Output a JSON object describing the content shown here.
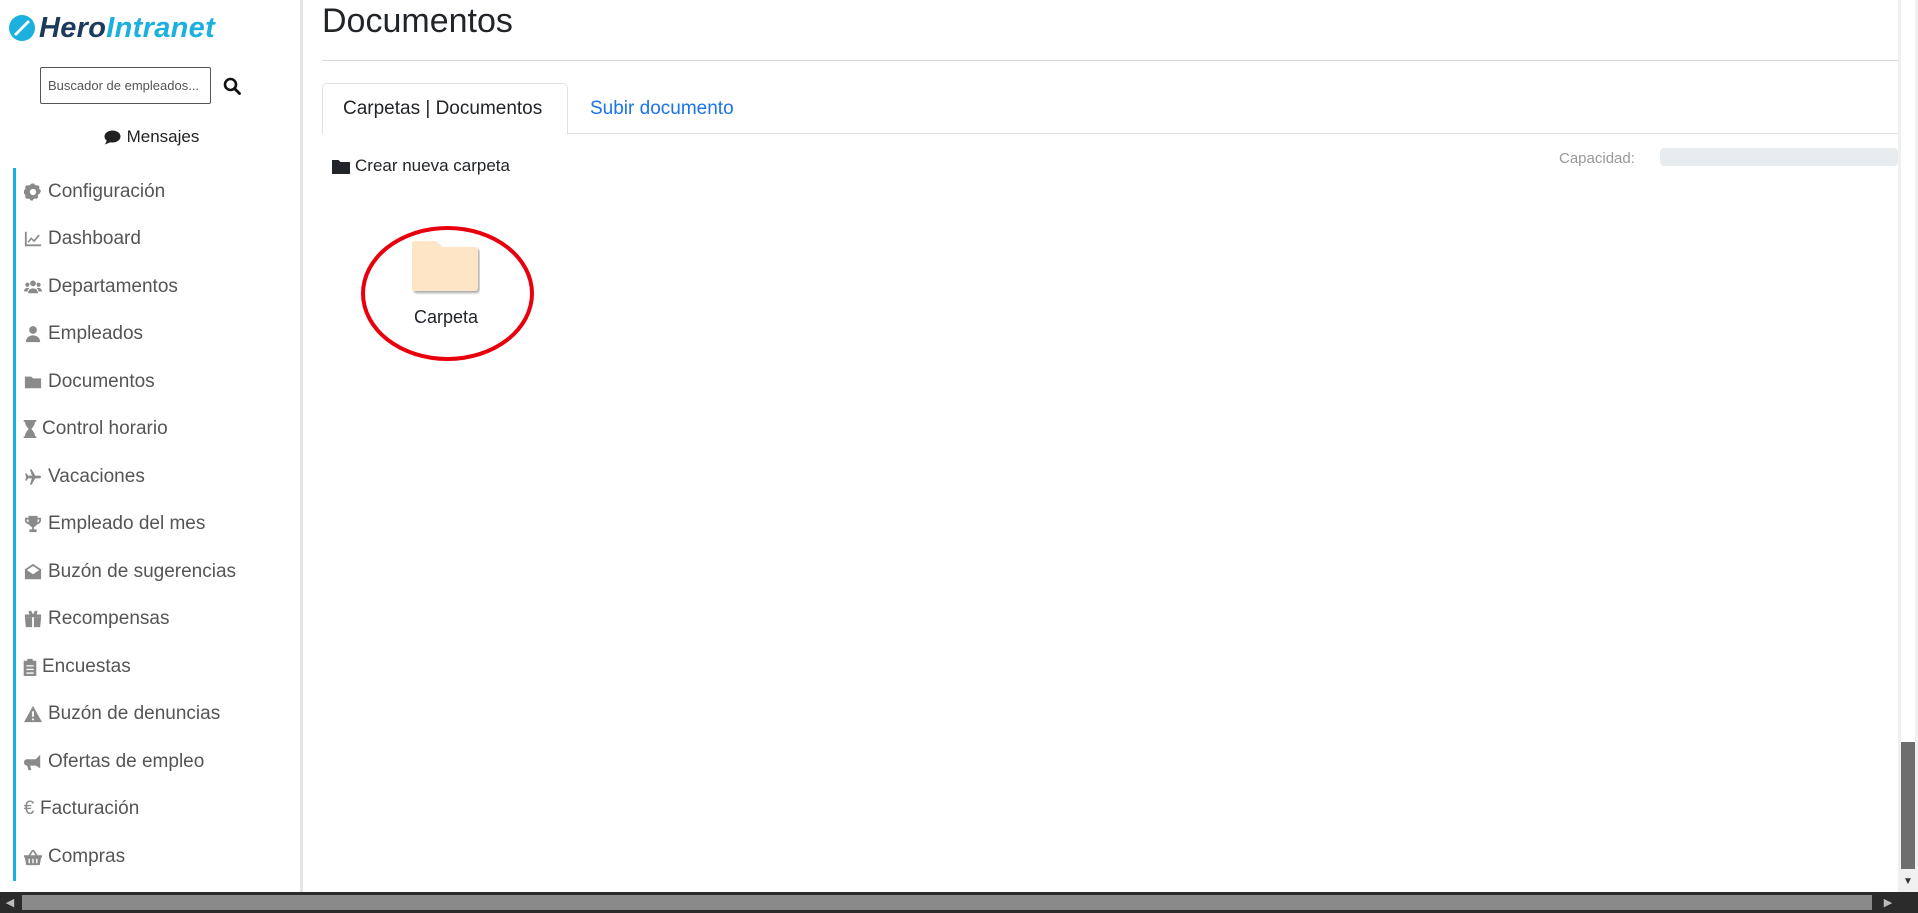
{
  "app": {
    "logo_part1": "Hero",
    "logo_part2": "Intranet",
    "brand_color": "#1cb0de"
  },
  "sidebar": {
    "search_placeholder": "Buscador de empleados...",
    "messages_label": "Mensajes",
    "items": [
      {
        "label": "Configuración",
        "icon": "gear-icon"
      },
      {
        "label": "Dashboard",
        "icon": "chart-line-icon"
      },
      {
        "label": "Departamentos",
        "icon": "users-icon"
      },
      {
        "label": "Empleados",
        "icon": "user-icon"
      },
      {
        "label": "Documentos",
        "icon": "folder-icon"
      },
      {
        "label": "Control horario",
        "icon": "hourglass-icon"
      },
      {
        "label": "Vacaciones",
        "icon": "plane-icon"
      },
      {
        "label": "Empleado del mes",
        "icon": "trophy-icon"
      },
      {
        "label": "Buzón de sugerencias",
        "icon": "envelope-open-icon"
      },
      {
        "label": "Recompensas",
        "icon": "gifts-icon"
      },
      {
        "label": "Encuestas",
        "icon": "clipboard-list-icon"
      },
      {
        "label": "Buzón de denuncias",
        "icon": "warning-icon"
      },
      {
        "label": "Ofertas de empleo",
        "icon": "bullhorn-icon"
      },
      {
        "label": "Facturación",
        "icon": "euro-icon"
      },
      {
        "label": "Compras",
        "icon": "basket-icon"
      }
    ]
  },
  "main": {
    "title": "Documentos",
    "tabs": [
      {
        "label": "Carpetas | Documentos",
        "active": true
      },
      {
        "label": "Subir documento",
        "active": false
      }
    ],
    "new_folder_label": "Crear nueva carpeta",
    "capacity_label": "Capacidad:",
    "capacity_fraction": 0,
    "folders": [
      {
        "name": "Carpeta",
        "color": "#fde5c6"
      }
    ],
    "highlight_color": "#e8000d"
  }
}
